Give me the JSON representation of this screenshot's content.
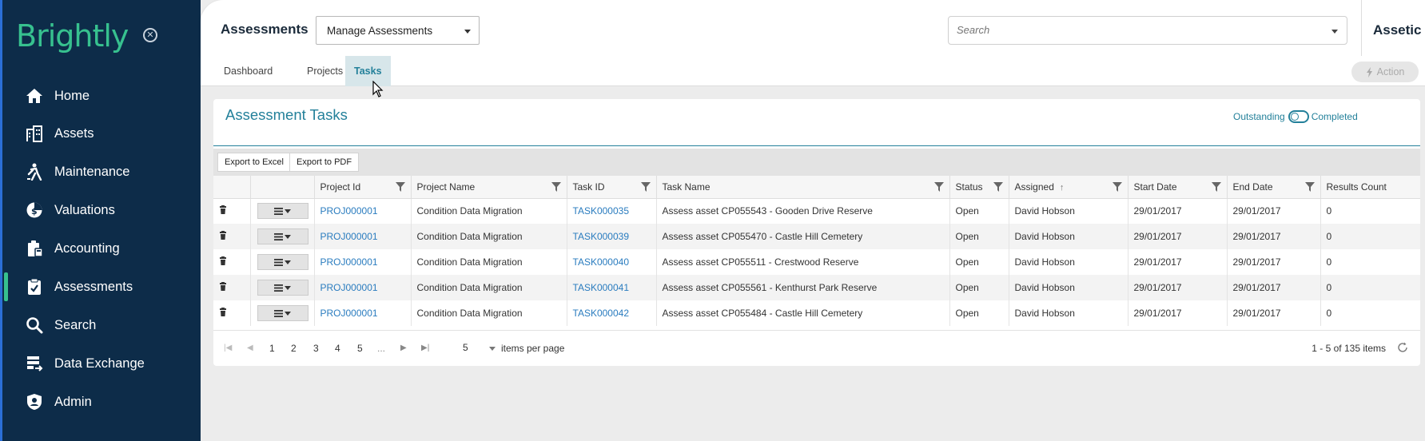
{
  "sidebar": {
    "logo": "Brightly",
    "items": [
      {
        "label": "Home"
      },
      {
        "label": "Assets"
      },
      {
        "label": "Maintenance"
      },
      {
        "label": "Valuations"
      },
      {
        "label": "Accounting"
      },
      {
        "label": "Assessments"
      },
      {
        "label": "Search"
      },
      {
        "label": "Data Exchange"
      },
      {
        "label": "Admin"
      }
    ],
    "active_item": "Assessments"
  },
  "header": {
    "module_title": "Assessments",
    "module_select_value": "Manage Assessments",
    "search_placeholder": "Search",
    "brand": "Assetic"
  },
  "subnav": {
    "tabs": [
      {
        "label": "Dashboard"
      },
      {
        "label": "Projects"
      },
      {
        "label": "Tasks"
      }
    ],
    "active_tab": "Tasks",
    "action_label": "Action"
  },
  "panel": {
    "title": "Assessment Tasks",
    "toggle_left": "Outstanding",
    "toggle_right": "Completed"
  },
  "toolbar": {
    "export_excel": "Export to Excel",
    "export_pdf": "Export to PDF"
  },
  "grid": {
    "columns": [
      "Project Id",
      "Project Name",
      "Task ID",
      "Task Name",
      "Status",
      "Assigned",
      "Start Date",
      "End Date",
      "Results Count"
    ],
    "sorted_column": "Assigned",
    "sort_direction": "ascending",
    "rows": [
      {
        "project_id": "PROJ000001",
        "project_name": "Condition Data Migration",
        "task_id": "TASK000035",
        "task_name": "Assess asset CP055543 - Gooden Drive Reserve",
        "status": "Open",
        "assigned": "David Hobson",
        "start": "29/01/2017",
        "end": "29/01/2017",
        "results": "0"
      },
      {
        "project_id": "PROJ000001",
        "project_name": "Condition Data Migration",
        "task_id": "TASK000039",
        "task_name": "Assess asset CP055470 - Castle Hill Cemetery",
        "status": "Open",
        "assigned": "David Hobson",
        "start": "29/01/2017",
        "end": "29/01/2017",
        "results": "0"
      },
      {
        "project_id": "PROJ000001",
        "project_name": "Condition Data Migration",
        "task_id": "TASK000040",
        "task_name": "Assess asset CP055511 - Crestwood Reserve",
        "status": "Open",
        "assigned": "David Hobson",
        "start": "29/01/2017",
        "end": "29/01/2017",
        "results": "0"
      },
      {
        "project_id": "PROJ000001",
        "project_name": "Condition Data Migration",
        "task_id": "TASK000041",
        "task_name": "Assess asset CP055561 - Kenthurst Park Reserve",
        "status": "Open",
        "assigned": "David Hobson",
        "start": "29/01/2017",
        "end": "29/01/2017",
        "results": "0"
      },
      {
        "project_id": "PROJ000001",
        "project_name": "Condition Data Migration",
        "task_id": "TASK000042",
        "task_name": "Assess asset CP055484 - Castle Hill Cemetery",
        "status": "Open",
        "assigned": "David Hobson",
        "start": "29/01/2017",
        "end": "29/01/2017",
        "results": "0"
      }
    ]
  },
  "pager": {
    "pages": [
      "1",
      "2",
      "3",
      "4",
      "5",
      "..."
    ],
    "page_size": "5",
    "items_per_page_label": "items per page",
    "summary": "1 - 5 of 135 items"
  },
  "colors": {
    "sidebar_bg": "#0d2c49",
    "brand_green": "#37c18f",
    "accent_teal": "#23809a",
    "link_blue": "#2a7cbf"
  }
}
